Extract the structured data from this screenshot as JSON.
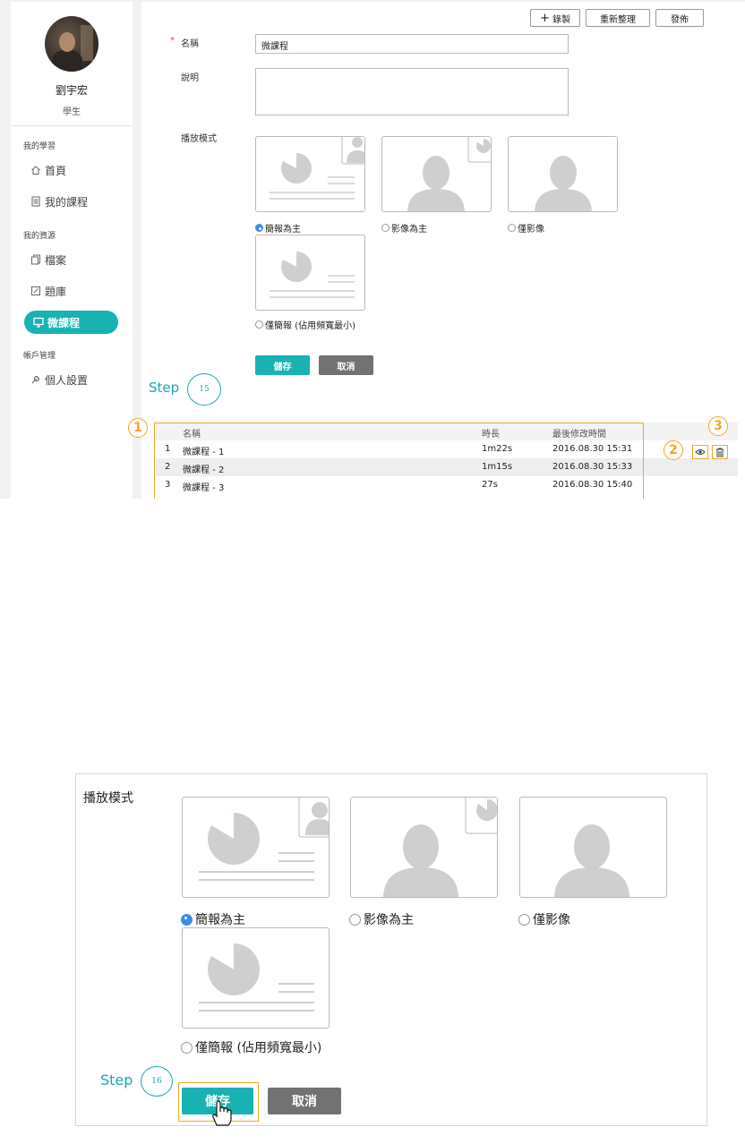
{
  "sidebar": {
    "user_name": "劉宇宏",
    "user_role": "學生",
    "sections": [
      {
        "title": "我的學習",
        "items": [
          {
            "label": "首頁",
            "icon": "home-icon"
          },
          {
            "label": "我的課程",
            "icon": "document-icon"
          }
        ]
      },
      {
        "title": "我的資源",
        "items": [
          {
            "label": "檔案",
            "icon": "files-icon"
          },
          {
            "label": "題庫",
            "icon": "question-bank-icon"
          },
          {
            "label": "微課程",
            "icon": "microcourse-icon",
            "active": true
          }
        ]
      },
      {
        "title": "帳戶管理",
        "items": [
          {
            "label": "個人設置",
            "icon": "wrench-icon"
          }
        ]
      }
    ]
  },
  "toolbar": {
    "record_label": "錄製",
    "refresh_label": "重新整理",
    "publish_label": "發佈"
  },
  "form": {
    "required_mark": "*",
    "name_label": "名稱",
    "name_value": "微課程",
    "desc_label": "說明",
    "desc_value": "",
    "mode_label": "播放模式",
    "modes": [
      {
        "label": "簡報為主",
        "selected": true
      },
      {
        "label": "影像為主",
        "selected": false
      },
      {
        "label": "僅影像",
        "selected": false
      },
      {
        "label": "僅簡報 (佔用頻寬最小)",
        "selected": false
      }
    ],
    "save_label": "儲存",
    "cancel_label": "取消"
  },
  "steps": {
    "step_word": "Step",
    "step_a": "15",
    "step_b": "16"
  },
  "table": {
    "headers": [
      "名稱",
      "時長",
      "最後修改時間"
    ],
    "rows": [
      {
        "index": "1",
        "name": "微課程 - 1",
        "duration": "1m22s",
        "modified": "2016.08.30 15:31"
      },
      {
        "index": "2",
        "name": "微課程 - 2",
        "duration": "1m15s",
        "modified": "2016.08.30 15:33"
      },
      {
        "index": "3",
        "name": "微課程 - 3",
        "duration": "27s",
        "modified": "2016.08.30 15:40"
      }
    ]
  },
  "callouts": [
    "1",
    "2",
    "3"
  ],
  "colors": {
    "accent": "#19b2b2",
    "callout": "#f5a623",
    "cancel": "#727272",
    "radio_on": "#3a8ee6"
  }
}
